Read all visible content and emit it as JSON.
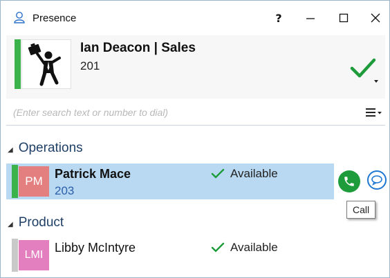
{
  "window": {
    "title": "Presence",
    "help_label": "?",
    "icons": [
      "person-outline-icon",
      "help-icon",
      "minimize-icon",
      "maximize-icon",
      "close-icon"
    ]
  },
  "user": {
    "name": "Ian Deacon | Sales",
    "extension": "201",
    "status_color": "#3bb34a",
    "presence_icon": "checkmark-dropdown-icon"
  },
  "search": {
    "placeholder": "(Enter search text or number to dial)",
    "value": ""
  },
  "groups": [
    {
      "name": "Operations",
      "contacts": [
        {
          "initials": "PM",
          "name": "Patrick Mace",
          "extension": "203",
          "presence": "Available",
          "status_color": "#3bb34a",
          "avatar_color": "#e47f7f",
          "selected": true
        }
      ]
    },
    {
      "name": "Product",
      "contacts": [
        {
          "initials": "LMI",
          "name": "Libby McIntyre",
          "presence": "Available",
          "status_color": "#c9c9c9",
          "avatar_color": "#e47fbf",
          "selected": false
        }
      ]
    }
  ],
  "tooltip": {
    "text": "Call"
  },
  "colors": {
    "accent_blue": "#1f78d1",
    "call_green": "#1e9b3b",
    "selection": "#b9d9f2",
    "group_text": "#1f3f66"
  }
}
